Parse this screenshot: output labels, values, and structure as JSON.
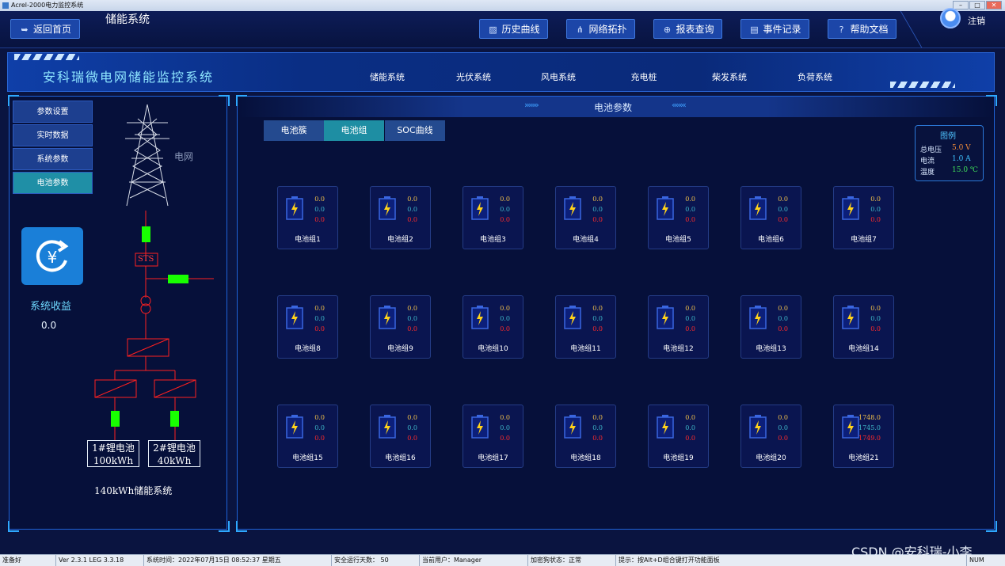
{
  "window": {
    "title": "Acrel-2000电力监控系统",
    "controls": [
      "–",
      "□",
      "✕"
    ]
  },
  "topbar": {
    "back_label": "返回首页",
    "page_title": "储能系统",
    "nav": [
      {
        "label": "历史曲线",
        "icon": "chart-line-icon"
      },
      {
        "label": "网络拓扑",
        "icon": "network-topology-icon"
      },
      {
        "label": "报表查询",
        "icon": "search-report-icon"
      },
      {
        "label": "事件记录",
        "icon": "document-icon"
      },
      {
        "label": "帮助文档",
        "icon": "help-icon"
      }
    ],
    "logout_label": "注销"
  },
  "header": {
    "title": "安科瑞微电网储能监控系统",
    "tabs": [
      "储能系统",
      "光伏系统",
      "风电系统",
      "充电桩",
      "柴发系统",
      "负荷系统"
    ]
  },
  "left_menu": [
    "参数设置",
    "实时数据",
    "系统参数",
    "电池参数"
  ],
  "left_menu_active": 3,
  "diagram": {
    "grid_label": "电网",
    "sts_label": "STS",
    "battery1": {
      "line1": "1#锂电池",
      "line2": "100kWh"
    },
    "battery2": {
      "line1": "2#锂电池",
      "line2": "40kWh"
    },
    "caption": "140kWh储能系统"
  },
  "revenue": {
    "label": "系统收益",
    "value": "0.0"
  },
  "panel": {
    "title": "电池参数",
    "tabs": [
      "电池簇",
      "电池组",
      "SOC曲线"
    ],
    "active_tab": 1
  },
  "legend": {
    "title": "图例",
    "rows": [
      {
        "label": "总电压",
        "value": "5.0 V",
        "color": "#f08a3a"
      },
      {
        "label": "电流",
        "value": "1.0 A",
        "color": "#3fc3ff"
      },
      {
        "label": "温度",
        "value": "15.0 ℃",
        "color": "#3fe05a"
      }
    ]
  },
  "battery_groups": [
    {
      "name": "电池组1",
      "voltage": "0.0",
      "current": "0.0",
      "temp": "0.0"
    },
    {
      "name": "电池组2",
      "voltage": "0.0",
      "current": "0.0",
      "temp": "0.0"
    },
    {
      "name": "电池组3",
      "voltage": "0.0",
      "current": "0.0",
      "temp": "0.0"
    },
    {
      "name": "电池组4",
      "voltage": "0.0",
      "current": "0.0",
      "temp": "0.0"
    },
    {
      "name": "电池组5",
      "voltage": "0.0",
      "current": "0.0",
      "temp": "0.0"
    },
    {
      "name": "电池组6",
      "voltage": "0.0",
      "current": "0.0",
      "temp": "0.0"
    },
    {
      "name": "电池组7",
      "voltage": "0.0",
      "current": "0.0",
      "temp": "0.0"
    },
    {
      "name": "电池组8",
      "voltage": "0.0",
      "current": "0.0",
      "temp": "0.0"
    },
    {
      "name": "电池组9",
      "voltage": "0.0",
      "current": "0.0",
      "temp": "0.0"
    },
    {
      "name": "电池组10",
      "voltage": "0.0",
      "current": "0.0",
      "temp": "0.0"
    },
    {
      "name": "电池组11",
      "voltage": "0.0",
      "current": "0.0",
      "temp": "0.0"
    },
    {
      "name": "电池组12",
      "voltage": "0.0",
      "current": "0.0",
      "temp": "0.0"
    },
    {
      "name": "电池组13",
      "voltage": "0.0",
      "current": "0.0",
      "temp": "0.0"
    },
    {
      "name": "电池组14",
      "voltage": "0.0",
      "current": "0.0",
      "temp": "0.0"
    },
    {
      "name": "电池组15",
      "voltage": "0.0",
      "current": "0.0",
      "temp": "0.0"
    },
    {
      "name": "电池组16",
      "voltage": "0.0",
      "current": "0.0",
      "temp": "0.0"
    },
    {
      "name": "电池组17",
      "voltage": "0.0",
      "current": "0.0",
      "temp": "0.0"
    },
    {
      "name": "电池组18",
      "voltage": "0.0",
      "current": "0.0",
      "temp": "0.0"
    },
    {
      "name": "电池组19",
      "voltage": "0.0",
      "current": "0.0",
      "temp": "0.0"
    },
    {
      "name": "电池组20",
      "voltage": "0.0",
      "current": "0.0",
      "temp": "0.0"
    },
    {
      "name": "电池组21",
      "voltage": "1748.0",
      "current": "1745.0",
      "temp": "1749.0"
    }
  ],
  "statusbar": [
    "准备好",
    "Ver 2.3.1 LEG 3.3.18",
    "系统时间：2022年07月15日  08:52:37   星期五",
    "安全运行天数：  50",
    "当前用户：Manager",
    "加密狗状态：正常",
    "提示：按Alt+D组合键打开功能面板",
    "NUM"
  ],
  "watermark": "CSDN @安科瑞-小李"
}
